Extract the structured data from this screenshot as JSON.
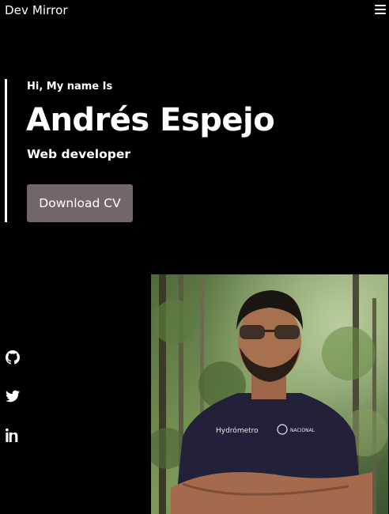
{
  "header": {
    "brand": "Dev Mirror",
    "menu_icon": "hamburger-menu-icon"
  },
  "hero": {
    "greeting": "Hi, My name Is",
    "name": "Andrés Espejo",
    "role": "Web developer",
    "cta_label": "Download CV"
  },
  "social": {
    "items": [
      {
        "icon": "github-icon"
      },
      {
        "icon": "twitter-icon"
      },
      {
        "icon": "linkedin-icon"
      }
    ]
  },
  "photo": {
    "shirt_text": "Hydrómetro",
    "badge_text": "NACIONAL"
  },
  "colors": {
    "background": "#000000",
    "text": "#ffffff",
    "button": "#736669"
  }
}
